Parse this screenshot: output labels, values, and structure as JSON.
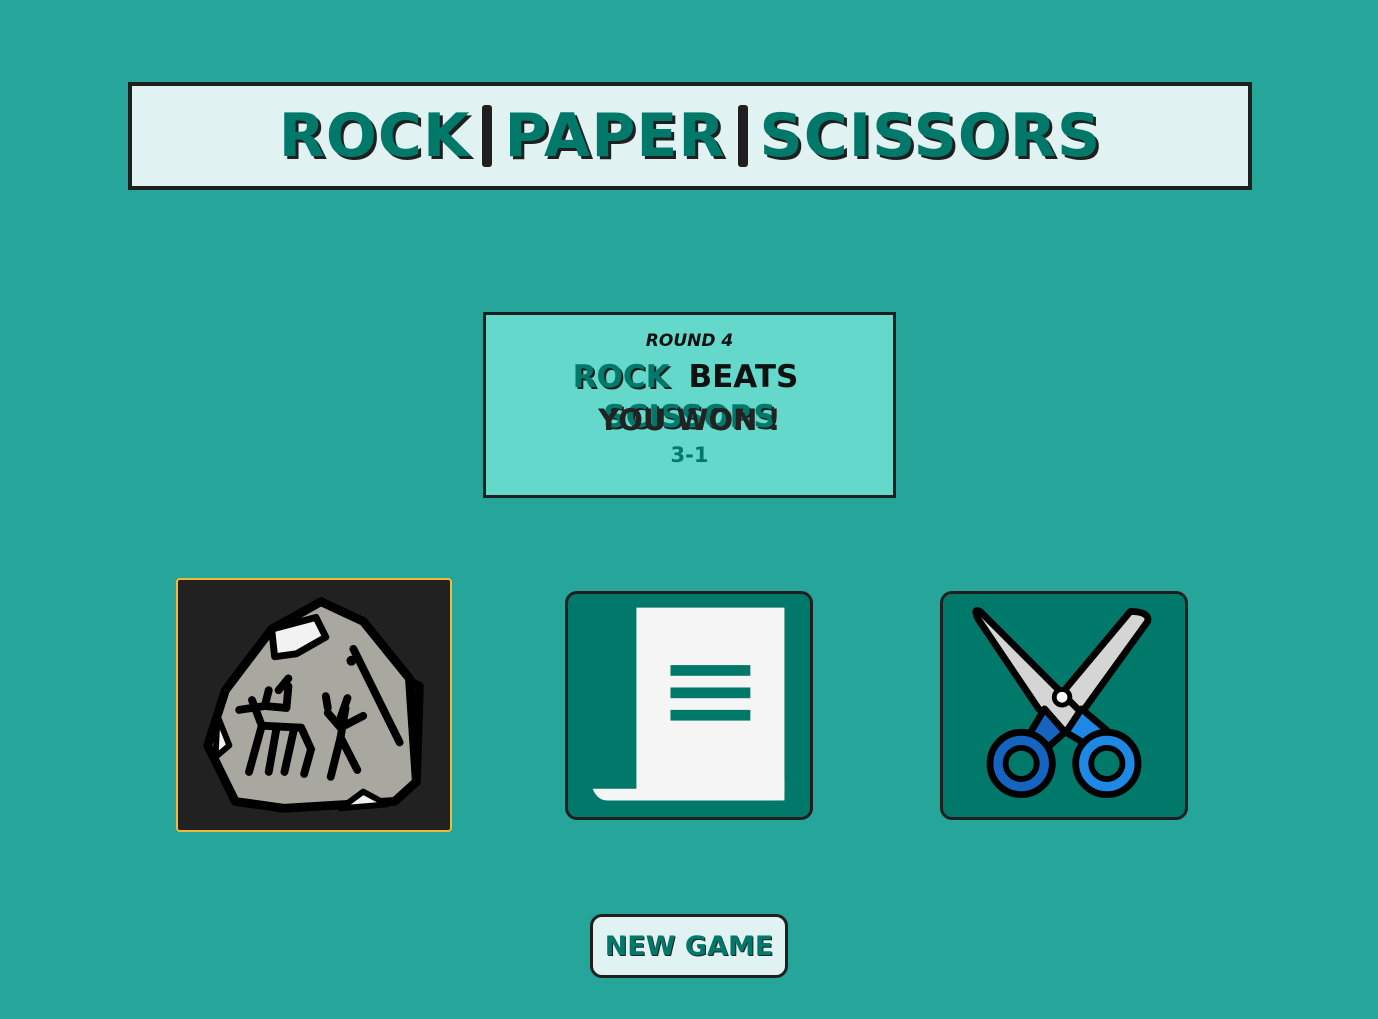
{
  "header": {
    "word_1": "ROCK",
    "word_2": "PAPER",
    "word_3": "SCISSORS"
  },
  "result": {
    "round_label": "ROUND 4",
    "winner_hand": "ROCK",
    "verb": "BEATS",
    "loser_hand": "SCISSORS",
    "outcome": "YOU WON !",
    "score": "3-1"
  },
  "choices": [
    {
      "id": "rock",
      "icon": "rock-icon",
      "selected": true
    },
    {
      "id": "paper",
      "icon": "paper-icon",
      "selected": false
    },
    {
      "id": "scissors",
      "icon": "scissors-icon",
      "selected": false
    }
  ],
  "controls": {
    "new_game_label": "NEW GAME"
  },
  "colors": {
    "background": "#26a69a",
    "accent": "#00796b",
    "title_panel": "#e0f2f1",
    "result_panel": "#64d8cb",
    "selected_border": "#f0b93a",
    "dark": "#1f1f1f"
  }
}
